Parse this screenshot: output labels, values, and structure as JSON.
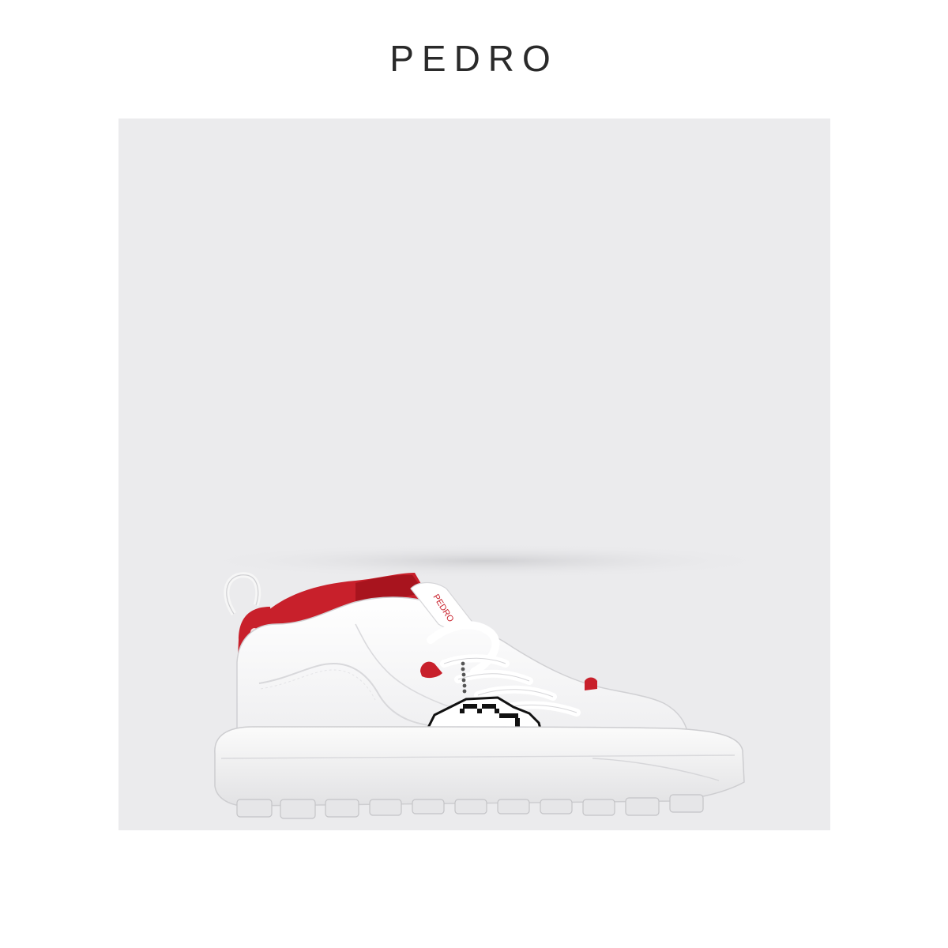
{
  "brand": {
    "name": "PEDRO"
  },
  "product": {
    "tongue_text": "PEDRO",
    "colors": {
      "backdrop": "#ebebed",
      "upper": "#f7f7f7",
      "accent_red": "#c8202b",
      "sole": "#f4f4f4",
      "outline": "#111111"
    }
  }
}
